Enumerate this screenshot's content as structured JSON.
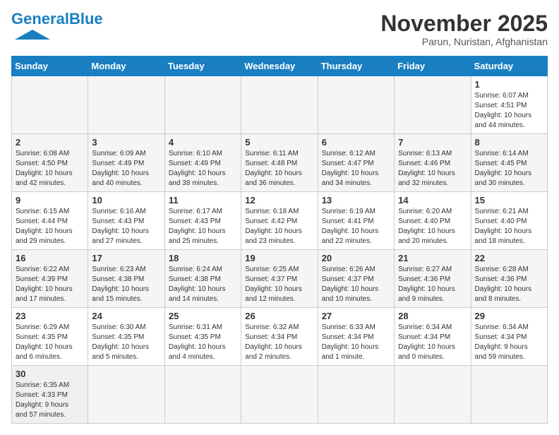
{
  "header": {
    "logo_general": "General",
    "logo_blue": "Blue",
    "month": "November 2025",
    "location": "Parun, Nuristan, Afghanistan"
  },
  "days_of_week": [
    "Sunday",
    "Monday",
    "Tuesday",
    "Wednesday",
    "Thursday",
    "Friday",
    "Saturday"
  ],
  "weeks": [
    [
      {
        "day": "",
        "info": ""
      },
      {
        "day": "",
        "info": ""
      },
      {
        "day": "",
        "info": ""
      },
      {
        "day": "",
        "info": ""
      },
      {
        "day": "",
        "info": ""
      },
      {
        "day": "",
        "info": ""
      },
      {
        "day": "1",
        "info": "Sunrise: 6:07 AM\nSunset: 4:51 PM\nDaylight: 10 hours\nand 44 minutes."
      }
    ],
    [
      {
        "day": "2",
        "info": "Sunrise: 6:08 AM\nSunset: 4:50 PM\nDaylight: 10 hours\nand 42 minutes."
      },
      {
        "day": "3",
        "info": "Sunrise: 6:09 AM\nSunset: 4:49 PM\nDaylight: 10 hours\nand 40 minutes."
      },
      {
        "day": "4",
        "info": "Sunrise: 6:10 AM\nSunset: 4:49 PM\nDaylight: 10 hours\nand 38 minutes."
      },
      {
        "day": "5",
        "info": "Sunrise: 6:11 AM\nSunset: 4:48 PM\nDaylight: 10 hours\nand 36 minutes."
      },
      {
        "day": "6",
        "info": "Sunrise: 6:12 AM\nSunset: 4:47 PM\nDaylight: 10 hours\nand 34 minutes."
      },
      {
        "day": "7",
        "info": "Sunrise: 6:13 AM\nSunset: 4:46 PM\nDaylight: 10 hours\nand 32 minutes."
      },
      {
        "day": "8",
        "info": "Sunrise: 6:14 AM\nSunset: 4:45 PM\nDaylight: 10 hours\nand 30 minutes."
      }
    ],
    [
      {
        "day": "9",
        "info": "Sunrise: 6:15 AM\nSunset: 4:44 PM\nDaylight: 10 hours\nand 29 minutes."
      },
      {
        "day": "10",
        "info": "Sunrise: 6:16 AM\nSunset: 4:43 PM\nDaylight: 10 hours\nand 27 minutes."
      },
      {
        "day": "11",
        "info": "Sunrise: 6:17 AM\nSunset: 4:43 PM\nDaylight: 10 hours\nand 25 minutes."
      },
      {
        "day": "12",
        "info": "Sunrise: 6:18 AM\nSunset: 4:42 PM\nDaylight: 10 hours\nand 23 minutes."
      },
      {
        "day": "13",
        "info": "Sunrise: 6:19 AM\nSunset: 4:41 PM\nDaylight: 10 hours\nand 22 minutes."
      },
      {
        "day": "14",
        "info": "Sunrise: 6:20 AM\nSunset: 4:40 PM\nDaylight: 10 hours\nand 20 minutes."
      },
      {
        "day": "15",
        "info": "Sunrise: 6:21 AM\nSunset: 4:40 PM\nDaylight: 10 hours\nand 18 minutes."
      }
    ],
    [
      {
        "day": "16",
        "info": "Sunrise: 6:22 AM\nSunset: 4:39 PM\nDaylight: 10 hours\nand 17 minutes."
      },
      {
        "day": "17",
        "info": "Sunrise: 6:23 AM\nSunset: 4:38 PM\nDaylight: 10 hours\nand 15 minutes."
      },
      {
        "day": "18",
        "info": "Sunrise: 6:24 AM\nSunset: 4:38 PM\nDaylight: 10 hours\nand 14 minutes."
      },
      {
        "day": "19",
        "info": "Sunrise: 6:25 AM\nSunset: 4:37 PM\nDaylight: 10 hours\nand 12 minutes."
      },
      {
        "day": "20",
        "info": "Sunrise: 6:26 AM\nSunset: 4:37 PM\nDaylight: 10 hours\nand 10 minutes."
      },
      {
        "day": "21",
        "info": "Sunrise: 6:27 AM\nSunset: 4:36 PM\nDaylight: 10 hours\nand 9 minutes."
      },
      {
        "day": "22",
        "info": "Sunrise: 6:28 AM\nSunset: 4:36 PM\nDaylight: 10 hours\nand 8 minutes."
      }
    ],
    [
      {
        "day": "23",
        "info": "Sunrise: 6:29 AM\nSunset: 4:35 PM\nDaylight: 10 hours\nand 6 minutes."
      },
      {
        "day": "24",
        "info": "Sunrise: 6:30 AM\nSunset: 4:35 PM\nDaylight: 10 hours\nand 5 minutes."
      },
      {
        "day": "25",
        "info": "Sunrise: 6:31 AM\nSunset: 4:35 PM\nDaylight: 10 hours\nand 4 minutes."
      },
      {
        "day": "26",
        "info": "Sunrise: 6:32 AM\nSunset: 4:34 PM\nDaylight: 10 hours\nand 2 minutes."
      },
      {
        "day": "27",
        "info": "Sunrise: 6:33 AM\nSunset: 4:34 PM\nDaylight: 10 hours\nand 1 minute."
      },
      {
        "day": "28",
        "info": "Sunrise: 6:34 AM\nSunset: 4:34 PM\nDaylight: 10 hours\nand 0 minutes."
      },
      {
        "day": "29",
        "info": "Sunrise: 6:34 AM\nSunset: 4:34 PM\nDaylight: 9 hours\nand 59 minutes."
      }
    ],
    [
      {
        "day": "30",
        "info": "Sunrise: 6:35 AM\nSunset: 4:33 PM\nDaylight: 9 hours\nand 57 minutes."
      },
      {
        "day": "",
        "info": ""
      },
      {
        "day": "",
        "info": ""
      },
      {
        "day": "",
        "info": ""
      },
      {
        "day": "",
        "info": ""
      },
      {
        "day": "",
        "info": ""
      },
      {
        "day": "",
        "info": ""
      }
    ]
  ]
}
